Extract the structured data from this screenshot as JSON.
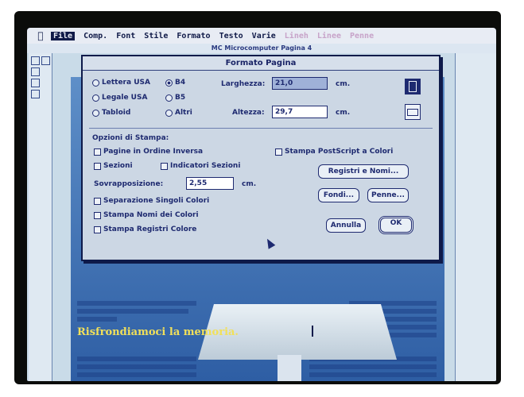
{
  "menubar": {
    "items": [
      "File",
      "Comp.",
      "Font",
      "Stile",
      "Formato",
      "Testo",
      "Varie",
      "Lineh",
      "Linee",
      "Penne"
    ],
    "active": "File"
  },
  "document": {
    "title": "MC Microcomputer Pagina 4",
    "headline": "Risfrondiamoci la memoria."
  },
  "dialog": {
    "title": "Formato Pagina",
    "paper_sizes": [
      {
        "label": "Lettera USA",
        "selected": false
      },
      {
        "label": "B4",
        "selected": true
      },
      {
        "label": "Legale USA",
        "selected": false
      },
      {
        "label": "B5",
        "selected": false
      },
      {
        "label": "Tabloid",
        "selected": false
      },
      {
        "label": "Altri",
        "selected": false
      }
    ],
    "width_label": "Larghezza:",
    "width_value": "21,0",
    "width_unit": "cm.",
    "height_label": "Altezza:",
    "height_value": "29,7",
    "height_unit": "cm.",
    "print_options_label": "Opzioni di Stampa:",
    "checkboxes": {
      "reverse_order": "Pagine in Ordine Inversa",
      "postscript_color": "Stampa PostScript a Colori",
      "sections": "Sezioni",
      "section_markers": "Indicatori Sezioni",
      "color_separation": "Separazione Singoli Colori",
      "print_color_names": "Stampa Nomi dei Colori",
      "print_color_registers": "Stampa Registri Colore"
    },
    "overlap_label": "Sovrapposizione:",
    "overlap_value": "2,55",
    "overlap_unit": "cm.",
    "buttons": {
      "registers_names": "Registri e Nomi...",
      "backgrounds": "Fondi...",
      "pens": "Penne...",
      "cancel": "Annulla",
      "ok": "OK"
    }
  }
}
